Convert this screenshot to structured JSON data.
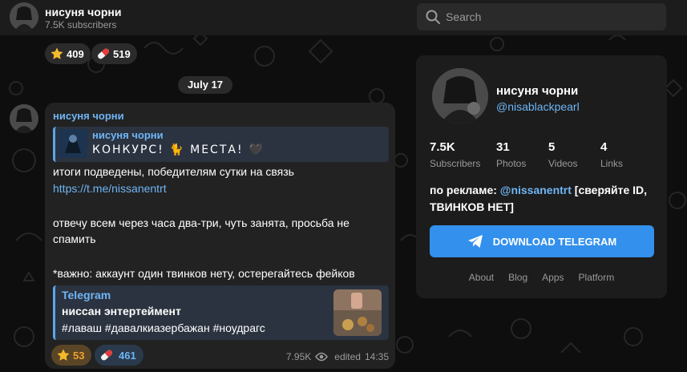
{
  "channel": {
    "title": "нисуня чорни",
    "subscribers_line": "7.5K subscribers",
    "handle": "@nisablackpearl"
  },
  "search": {
    "placeholder": "Search"
  },
  "top_reactions": [
    {
      "icon": "star-emoji-icon",
      "count": "409"
    },
    {
      "icon": "pill-emoji-icon",
      "count": "519"
    }
  ],
  "date_pill": "July 17",
  "message": {
    "author": "нисуня чорни",
    "forward": {
      "title": "нисуня чорни",
      "decor_text": "КОНКУРС! 🐈 МЕСТА! 🖤"
    },
    "lines": [
      "итоги подведены, победителям сутки на связь",
      "https://t.me/nissanentrt",
      "отвечу всем через часа два-три, чуть занята, просьба не",
      "спамить",
      "*важно: аккаунт один твинков нету, остерегайтесь фейков"
    ],
    "preview": {
      "site": "Telegram",
      "title": "ниссан энтертеймент",
      "description": "#лаваш #давалкиазербажан #ноудрагс"
    },
    "reactions": [
      {
        "icon": "star-emoji-icon",
        "count": "53"
      },
      {
        "icon": "pill-emoji-icon",
        "count": "461"
      }
    ],
    "views": "7.95K",
    "edited_label": "edited",
    "time": "14:35"
  },
  "card": {
    "name": "нисуня чорни",
    "handle": "@nisablackpearl",
    "stats": [
      {
        "value": "7.5K",
        "label": "Subscribers"
      },
      {
        "value": "31",
        "label": "Photos"
      },
      {
        "value": "5",
        "label": "Videos"
      },
      {
        "value": "4",
        "label": "Links"
      }
    ],
    "description_prefix": "по рекламе: ",
    "description_link": "@nissanentrt",
    "description_suffix": " [сверяйте ID, ТВИНКОВ НЕТ]",
    "download_label": "DOWNLOAD TELEGRAM",
    "footer_links": [
      "About",
      "Blog",
      "Apps",
      "Platform"
    ]
  },
  "colors": {
    "accent": "#3390ec",
    "link": "#6fb5f5",
    "reaction_active": "#f0a030"
  }
}
